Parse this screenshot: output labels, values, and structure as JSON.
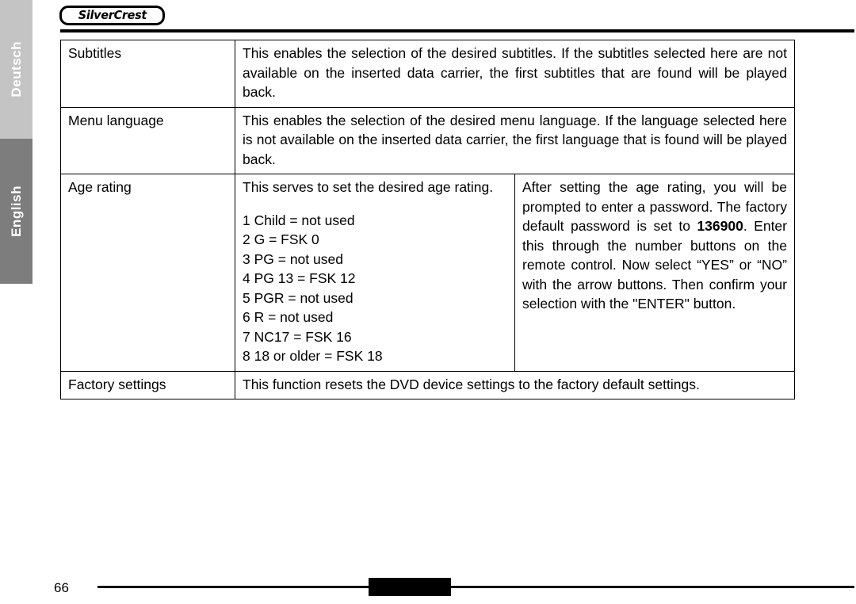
{
  "header": {
    "brand_logo": "SilverCrest"
  },
  "side_tabs": [
    {
      "label": "Deutsch",
      "state": "inactive",
      "bg_color": "#c4c4c4",
      "text_color": "#ffffff"
    },
    {
      "label": "English",
      "state": "active",
      "bg_color": "#7d7d7d",
      "text_color": "#ffffff"
    }
  ],
  "table": {
    "rows": [
      {
        "label": "Subtitles",
        "description": "This enables the selection of the desired subtitles. If the subtitles selected here are not available on the inserted data carrier, the first subtitles that are found will be played back.",
        "spans_columns": 2
      },
      {
        "label": "Menu language",
        "description": "This enables the selection of the desired menu language. If the language selected here is not available on the inserted data carrier, the first language that is found will be played back.",
        "spans_columns": 2
      },
      {
        "label": "Age rating",
        "middle_intro": "This serves to set the desired age rating.",
        "middle_list": [
          "1 Child = not used",
          "2 G = FSK 0",
          "3 PG = not used",
          "4 PG 13 = FSK 12",
          "5 PGR = not used",
          "6 R = not used",
          "7 NC17 = FSK 16",
          "8 18 or older = FSK 18"
        ],
        "description_part1": "After setting the age rating, you will be prompted to enter a password. The factory default password is set to ",
        "description_bold": "136900",
        "description_part2": ". Enter this through the number buttons on the remote control. Now select “YES” or “NO” with the arrow buttons. Then confirm your selection with the \"ENTER\" button.",
        "spans_columns": 1
      },
      {
        "label": "Factory settings",
        "description": "This function resets the DVD device settings to the factory default settings.",
        "spans_columns": 2
      }
    ]
  },
  "footer": {
    "page_number": "66"
  }
}
